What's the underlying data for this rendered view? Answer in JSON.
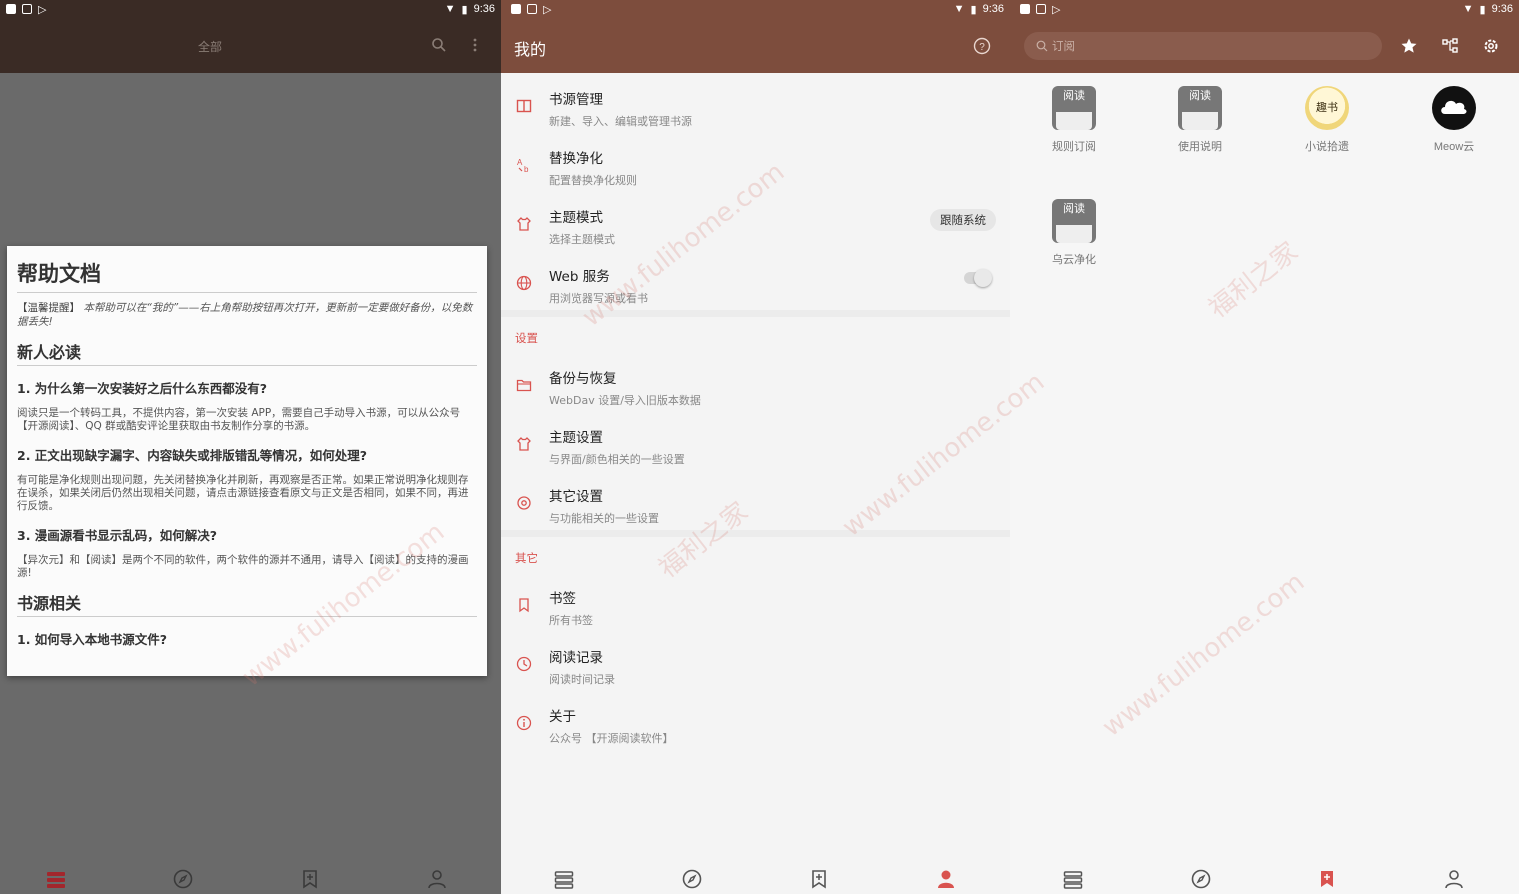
{
  "status": {
    "time": "9:36"
  },
  "panel1": {
    "appbar_title": "全部",
    "dialog": {
      "title": "帮助文档",
      "note_prefix": "【温馨提醒】",
      "note_body": "本帮助可以在“我的”——右上角帮助按钮再次打开，更新前一定要做好备份，以免数据丢失!",
      "section1": "新人必读",
      "q1": "1. 为什么第一次安装好之后什么东西都没有?",
      "a1": "阅读只是一个转码工具，不提供内容，第一次安装 APP，需要自己手动导入书源，可以从公众号 【开源阅读】、QQ 群或酷安评论里获取由书友制作分享的书源。",
      "q2": "2. 正文出现缺字漏字、内容缺失或排版错乱等情况，如何处理?",
      "a2": "有可能是净化规则出现问题，先关闭替换净化并刷新，再观察是否正常。如果正常说明净化规则存在误杀，如果关闭后仍然出现相关问题，请点击源链接查看原文与正文是否相同，如果不同，再进行反馈。",
      "q3": "3. 漫画源看书显示乱码，如何解决?",
      "a3": "【异次元】和【阅读】是两个不同的软件，两个软件的源并不通用，请导入【阅读】的支持的漫画源!",
      "section2": "书源相关",
      "q4": "1. 如何导入本地书源文件?"
    }
  },
  "panel2": {
    "appbar_title": "我的",
    "items": [
      {
        "title": "书源管理",
        "sub": "新建、导入、编辑或管理书源"
      },
      {
        "title": "替换净化",
        "sub": "配置替换净化规则"
      },
      {
        "title": "主题模式",
        "sub": "选择主题模式"
      },
      {
        "title": "Web 服务",
        "sub": "用浏览器写源或看书"
      }
    ],
    "theme_chip": "跟随系统",
    "web_service_on": false,
    "section_settings": "设置",
    "settings": [
      {
        "title": "备份与恢复",
        "sub": "WebDav 设置/导入旧版本数据"
      },
      {
        "title": "主题设置",
        "sub": "与界面/颜色相关的一些设置"
      },
      {
        "title": "其它设置",
        "sub": "与功能相关的一些设置"
      }
    ],
    "section_other": "其它",
    "other": [
      {
        "title": "书签",
        "sub": "所有书签"
      },
      {
        "title": "阅读记录",
        "sub": "阅读时间记录"
      },
      {
        "title": "关于",
        "sub": "公众号 【开源阅读软件】"
      }
    ]
  },
  "panel3": {
    "search_placeholder": "订阅",
    "icon_text": "阅读",
    "novel_icon_text": "趣书",
    "subscriptions": [
      {
        "label": "规则订阅"
      },
      {
        "label": "使用说明"
      },
      {
        "label": "小说拾遗"
      },
      {
        "label": "Meow云"
      },
      {
        "label": "乌云净化"
      }
    ]
  },
  "watermark": {
    "site": "www.fulihome.com",
    "name": "福利之家"
  },
  "colors": {
    "appbar": "#7d4d3d",
    "accent": "#d9534f",
    "dim_appbar": "#3a2b25"
  }
}
